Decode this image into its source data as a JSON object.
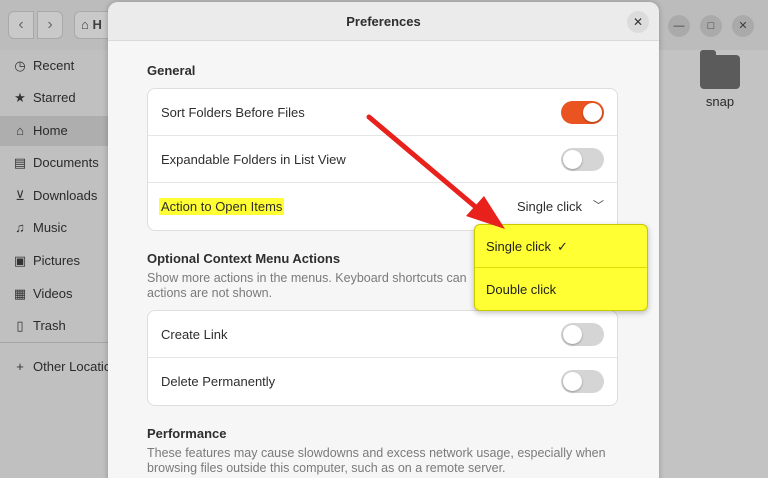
{
  "file_manager": {
    "path_label": "H",
    "sidebar": {
      "items": [
        {
          "label": "Recent",
          "icon": "clock-icon",
          "glyph": "◷"
        },
        {
          "label": "Starred",
          "icon": "star-icon",
          "glyph": "★"
        },
        {
          "label": "Home",
          "icon": "home-icon",
          "glyph": "⌂"
        },
        {
          "label": "Documents",
          "icon": "document-icon",
          "glyph": "▤"
        },
        {
          "label": "Downloads",
          "icon": "download-icon",
          "glyph": "⊻"
        },
        {
          "label": "Music",
          "icon": "music-icon",
          "glyph": "♫"
        },
        {
          "label": "Pictures",
          "icon": "picture-icon",
          "glyph": "▣"
        },
        {
          "label": "Videos",
          "icon": "video-icon",
          "glyph": "▦"
        },
        {
          "label": "Trash",
          "icon": "trash-icon",
          "glyph": "🗑"
        },
        {
          "label": "Other Locations",
          "icon": "plus-icon",
          "glyph": "+"
        }
      ]
    },
    "folder_label": "snap"
  },
  "dialog": {
    "title": "Preferences",
    "general": {
      "title": "General",
      "sort_folders_label": "Sort Folders Before Files",
      "expandable_folders_label": "Expandable Folders in List View",
      "action_label": "Action to Open Items",
      "action_value": "Single click"
    },
    "context_menu": {
      "title": "Optional Context Menu Actions",
      "desc_line1": "Show more actions in the menus. Keyboard shortcuts can",
      "desc_line2": "actions are not shown.",
      "create_link_label": "Create Link",
      "delete_permanently_label": "Delete Permanently"
    },
    "performance": {
      "title": "Performance",
      "desc_line1": "These features may cause slowdowns and excess network usage, especially when",
      "desc_line2": "browsing files outside this computer, such as on a remote server."
    },
    "toggles": {
      "sort_folders": true,
      "expandable_folders": false,
      "create_link": false,
      "delete_permanently": false
    }
  },
  "dropdown": {
    "options": [
      "Single click",
      "Double click"
    ],
    "selected": "Single click"
  },
  "colors": {
    "accent": "#e95420",
    "highlight": "#ffff33",
    "arrow": "#e8211c"
  }
}
